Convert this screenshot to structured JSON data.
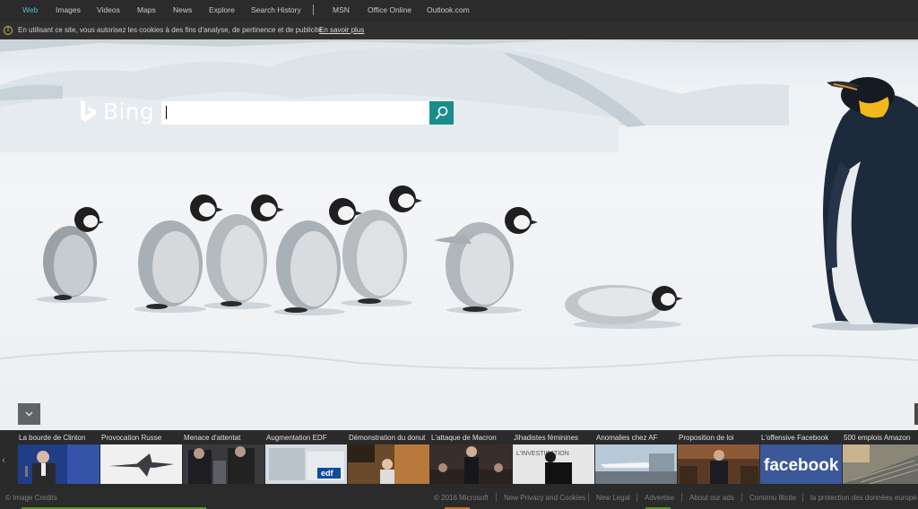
{
  "nav": {
    "items": [
      "Web",
      "Images",
      "Videos",
      "Maps",
      "News",
      "Explore",
      "Search History",
      "MSN",
      "Office Online",
      "Outlook.com"
    ],
    "active_index": 0,
    "accent_color": "#4ec3c8"
  },
  "cookie_bar": {
    "icon": "warning-icon",
    "text": "En utilisant ce site, vous autorisez les cookies à des fins d'analyse, de pertinence et de publicité.",
    "link": "En savoir plus"
  },
  "logo": {
    "text": "Bing",
    "icon": "bing-logo-icon"
  },
  "search": {
    "value": "",
    "placeholder": "",
    "button_icon": "search-icon",
    "button_color": "#1a8c8c"
  },
  "news": {
    "items": [
      {
        "label": "La bourde de Clinton"
      },
      {
        "label": "Provocation Russe"
      },
      {
        "label": "Menace d'attentat"
      },
      {
        "label": "Augmentation EDF"
      },
      {
        "label": "Démonstration du donut"
      },
      {
        "label": "L'attaque de Macron"
      },
      {
        "label": "Jihadistes féminines"
      },
      {
        "label": "Anomalies chez AF"
      },
      {
        "label": "Proposition de loi"
      },
      {
        "label": "L'offensive Facebook"
      },
      {
        "label": "500 emplois Amazon"
      }
    ],
    "thumb_text_facebook": "facebook",
    "thumb_text_edf": "edf",
    "thumb_text_investigation": "L'INVESTIGATION"
  },
  "footer": {
    "image_credits": "© Image Credits",
    "links": [
      "© 2016 Microsoft",
      "New Privacy and Cookies",
      "New Legal",
      "Advertise",
      "About our ads",
      "Contenu illicite",
      "la protection des données europé"
    ]
  }
}
